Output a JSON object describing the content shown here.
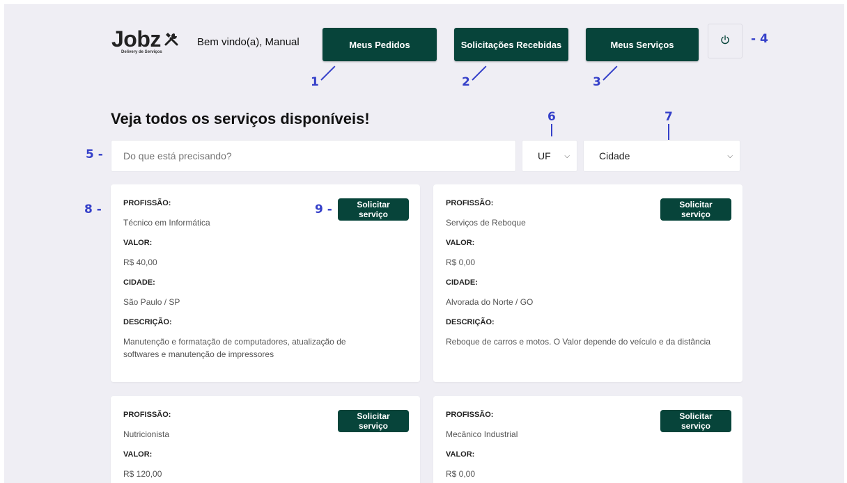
{
  "header": {
    "logo_text": "Jobz",
    "logo_sub": "Delivery de Serviços",
    "welcome": "Bem vindo(a), Manual",
    "buttons": {
      "meus_pedidos": "Meus Pedidos",
      "solicitacoes": "Solicitações Recebidas",
      "meus_servicos": "Meus Serviços"
    }
  },
  "annotations": {
    "a1": "1",
    "a2": "2",
    "a3": "3",
    "a4": "- 4",
    "a5": "5 -",
    "a6": "6",
    "a7": "7",
    "a8": "8 -",
    "a9": "9 -"
  },
  "main": {
    "title": "Veja todos os serviços disponíveis!",
    "search_placeholder": "Do que está precisando?",
    "uf_selected": "UF",
    "city_selected": "Cidade"
  },
  "labels": {
    "profissao": "PROFISSÃO:",
    "valor": "VALOR:",
    "cidade": "CIDADE:",
    "descricao": "DESCRIÇÃO:",
    "request_button": "Solicitar serviço"
  },
  "services": [
    {
      "profissao": "Técnico em Informática",
      "valor": "R$ 40,00",
      "cidade": "São Paulo / SP",
      "descricao": "Manutenção e formatação de computadores, atualização de softwares e manutenção de impressores"
    },
    {
      "profissao": "Serviços de Reboque",
      "valor": "R$ 0,00",
      "cidade": "Alvorada do Norte / GO",
      "descricao": "Reboque de carros e motos. O Valor depende do veículo e da distância"
    },
    {
      "profissao": "Nutricionista",
      "valor": "R$ 120,00"
    },
    {
      "profissao": "Mecânico Industrial",
      "valor": "R$ 0,00"
    }
  ],
  "colors": {
    "primary": "#07443a",
    "background": "#efeef4",
    "annotation": "#3540c9"
  }
}
